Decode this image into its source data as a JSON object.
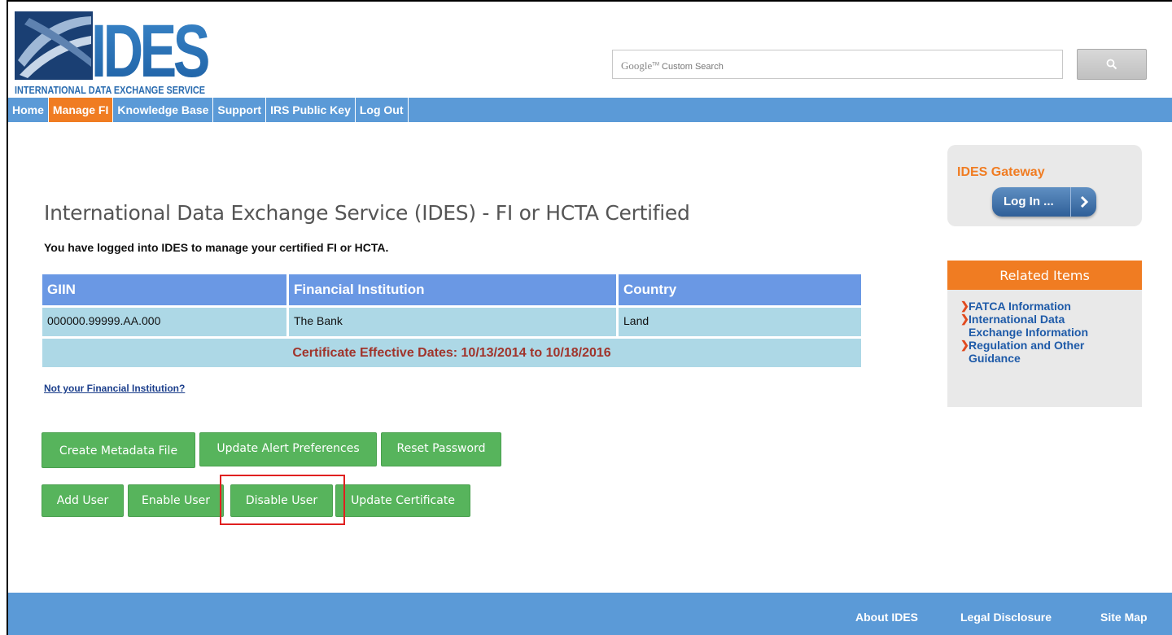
{
  "logo": {
    "wordmark": "IDES",
    "tagline": "INTERNATIONAL DATA EXCHANGE SERVICE"
  },
  "search": {
    "brand": "Google",
    "tm": "TM",
    "placeholder": "Custom Search",
    "icon": "search-icon"
  },
  "nav": {
    "items": [
      {
        "label": "Home"
      },
      {
        "label": "Manage FI",
        "active": true
      },
      {
        "label": "Knowledge Base"
      },
      {
        "label": "Support"
      },
      {
        "label": "IRS Public Key"
      },
      {
        "label": "Log Out"
      }
    ]
  },
  "main": {
    "title": "International Data Exchange Service (IDES) - FI or HCTA Certified",
    "subtitle": "You have logged into IDES to manage your certified FI or HCTA.",
    "table": {
      "headers": [
        "GIIN",
        "Financial Institution",
        "Country"
      ],
      "row": [
        "000000.99999.AA.000",
        "The Bank",
        "Land"
      ],
      "certificate": "Certificate Effective Dates: 10/13/2014 to 10/18/2016"
    },
    "not_your_fi": "Not your Financial Institution?",
    "buttons": {
      "create_metadata": "Create Metadata File",
      "update_alert": "Update Alert Preferences",
      "reset_password": "Reset Password",
      "add_user": "Add User",
      "enable_user": "Enable User",
      "disable_user": "Disable User",
      "update_certificate": "Update Certificate"
    }
  },
  "gateway": {
    "title": "IDES Gateway",
    "login_label": "Log In ...",
    "arrow_icon": "chevron-right-icon"
  },
  "related": {
    "title": "Related Items",
    "items": [
      {
        "line1": "FATCA Information",
        "line2": ""
      },
      {
        "line1": "International Data",
        "line2": "Exchange Information"
      },
      {
        "line1": "Regulation and Other",
        "line2": "Guidance"
      }
    ]
  },
  "footer": {
    "about": "About IDES",
    "legal": "Legal Disclosure",
    "sitemap": "Site Map"
  },
  "colors": {
    "nav_bg": "#5b9ad7",
    "accent_orange": "#f07c22",
    "button_green": "#57b45c",
    "table_header": "#6a98e4",
    "table_row": "#add8e6",
    "cert_text": "#a0342b",
    "highlight_red": "#e02020"
  }
}
